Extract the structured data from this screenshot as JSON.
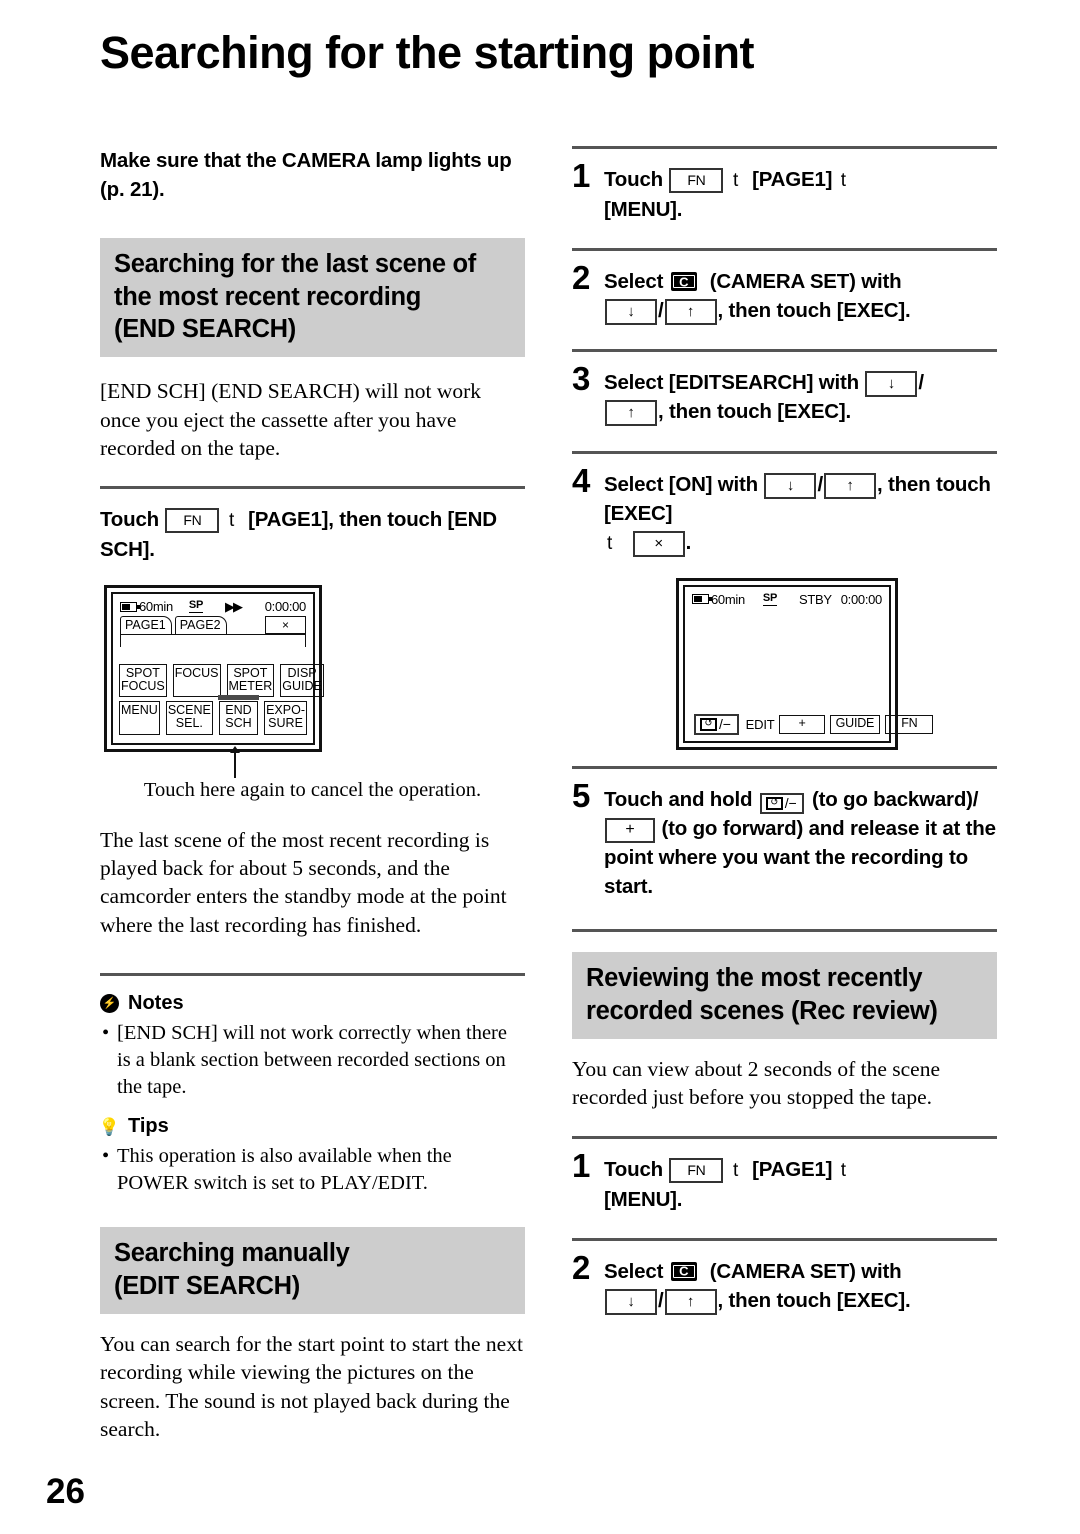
{
  "page": {
    "title": "Searching for the starting point",
    "number": "26"
  },
  "left": {
    "lead": "Make sure that the CAMERA lamp lights up (p. 21).",
    "heading_end_search": {
      "line1": "Searching for the last scene of",
      "line2": "the most recent recording",
      "line3": "(END SEARCH)"
    },
    "body_end_search": "[END SCH] (END SEARCH) will not work once you eject the cassette after you have recorded on the tape.",
    "instruction": {
      "prefix": "Touch",
      "key_fn": "FN",
      "arrow": "t",
      "middle": "[PAGE1], then touch",
      "suffix": "[END SCH]."
    },
    "lcd1": {
      "battery": "60min",
      "sp": "SP",
      "transport": "▶▶",
      "timecode": "0:00:00",
      "tab1": "PAGE1",
      "tab2": "PAGE2",
      "close": "×",
      "buttons_row1": [
        {
          "l1": "SPOT",
          "l2": "FOCUS"
        },
        {
          "l1": "FOCUS",
          "l2": ""
        },
        {
          "l1": "SPOT",
          "l2": "METER"
        },
        {
          "l1": "DISP",
          "l2": "GUIDE"
        }
      ],
      "buttons_row2": [
        {
          "l1": "MENU",
          "l2": ""
        },
        {
          "l1": "SCENE",
          "l2": "SEL."
        },
        {
          "l1": "END",
          "l2": "SCH"
        },
        {
          "l1": "EXPO-",
          "l2": "SURE"
        }
      ]
    },
    "lcd1_caption": "Touch here again to cancel the operation.",
    "body_last_scene": "The last scene of the most recent recording is played back for about 5 seconds, and the camcorder enters the standby mode at the point where the last recording has finished.",
    "notes": {
      "title": "Notes",
      "items": [
        "[END SCH] will not work correctly when there is a blank section between recorded sections on the tape."
      ]
    },
    "tips": {
      "title": "Tips",
      "items": [
        "This operation is also available when the POWER switch is set to PLAY/EDIT."
      ]
    },
    "heading_edit_search": {
      "line1": "Searching manually",
      "line2": "(EDIT SEARCH)"
    },
    "body_edit_search": "You can search for the start point to start the next recording while viewing the pictures on the screen. The sound is not played back during the search."
  },
  "right": {
    "steps_edit": [
      {
        "num": "1",
        "p1": "Touch",
        "key_fn": "FN",
        "arrow1": "t",
        "p2": "[PAGE1]",
        "arrow2": "t",
        "p3": "[MENU]."
      },
      {
        "num": "2",
        "p1": "Select",
        "icon": "camera-set-icon",
        "p2": "(CAMERA SET) with",
        "key_down": "↓",
        "sep": "/",
        "key_up": "↑",
        "p3": ", then touch [EXEC]."
      },
      {
        "num": "3",
        "p1": "Select [EDITSEARCH] with",
        "key_down": "↓",
        "sep": "/",
        "key_up": "↑",
        "p3": ", then touch [EXEC]."
      },
      {
        "num": "4",
        "p1": "Select [ON] with",
        "key_down": "↓",
        "sep": "/",
        "key_up": "↑",
        "p2": ", then touch [EXEC]",
        "arrow": "t",
        "key_x": "×",
        "p3": "."
      }
    ],
    "lcd2": {
      "battery": "60min",
      "sp": "SP",
      "status": "STBY",
      "timecode": "0:00:00",
      "bar_rev": "/−",
      "bar_edit": "EDIT",
      "bar_plus": "+",
      "bar_guide": "GUIDE",
      "bar_fn": "FN"
    },
    "step5": {
      "num": "5",
      "p1": "Touch and hold",
      "rev_key": "/−",
      "p2": "(to go backward)/",
      "plus_key": "+",
      "p3": "(to go forward) and release it at the point where you want the recording to start."
    },
    "heading_rec_review": {
      "line1": "Reviewing the most recently",
      "line2": "recorded scenes (Rec review)"
    },
    "body_rec_review": "You can view about 2 seconds of the scene recorded just before you stopped the tape.",
    "steps_review": [
      {
        "num": "1",
        "p1": "Touch",
        "key_fn": "FN",
        "arrow1": "t",
        "p2": "[PAGE1]",
        "arrow2": "t",
        "p3": "[MENU]."
      },
      {
        "num": "2",
        "p1": "Select",
        "icon": "camera-set-icon",
        "p2": "(CAMERA SET) with",
        "key_down": "↓",
        "sep": "/",
        "key_up": "↑",
        "p3": ", then touch [EXEC]."
      }
    ]
  }
}
